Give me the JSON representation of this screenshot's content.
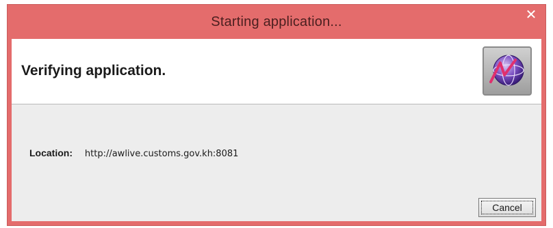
{
  "window": {
    "title": "Starting application...",
    "close_glyph": "✕",
    "title_bar_color": "#e46c6c"
  },
  "header": {
    "heading": "Verifying application.",
    "app_icon": "java-web-start-icon"
  },
  "body": {
    "location_label": "Location:",
    "location_value": "http://awlive.customs.gov.kh:8081"
  },
  "buttons": {
    "cancel_label": "Cancel"
  }
}
